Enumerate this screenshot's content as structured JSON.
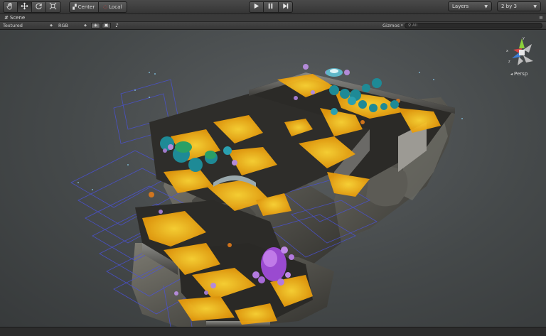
{
  "toolbar": {
    "transform_tools": [
      {
        "name": "hand-icon",
        "active": false
      },
      {
        "name": "move-icon",
        "active": true
      },
      {
        "name": "rotate-icon",
        "active": false
      },
      {
        "name": "scale-icon",
        "active": false
      }
    ],
    "pivot_label": "Center",
    "rotation_label": "Local",
    "play_icons": [
      "play-icon",
      "pause-icon",
      "step-icon"
    ],
    "layers_label": "Layers",
    "layout_label": "2 by 3"
  },
  "scene_tab": {
    "title": "Scene",
    "icon": "scene-grid-icon"
  },
  "scene_bar": {
    "render_mode": "Textured",
    "color_mode": "RGB",
    "gizmos_label": "Gizmos",
    "search_placeholder": "All",
    "toggle_icons": [
      "lighting-icon",
      "image-effects-icon",
      "audio-icon"
    ]
  },
  "viewport": {
    "projection_label": "Persp",
    "gizmo_axes": [
      "y",
      "x",
      "z"
    ],
    "axis_colors": {
      "x": "#d64545",
      "y": "#8ccf3a",
      "z": "#3f7fd6"
    }
  }
}
